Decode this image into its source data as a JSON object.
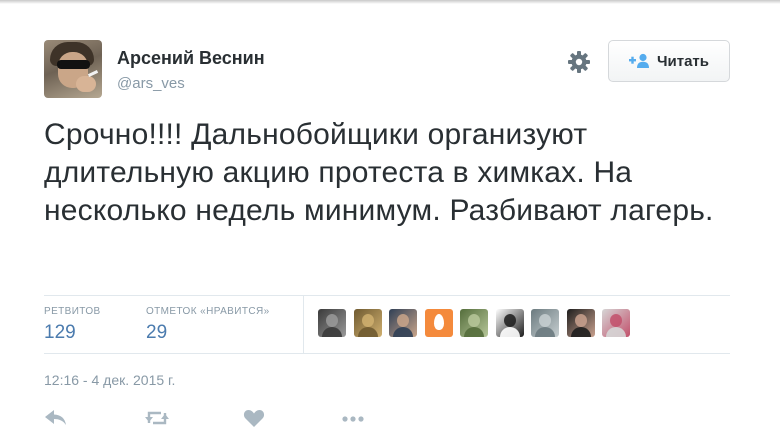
{
  "author": {
    "name": "Арсений Веснин",
    "handle": "@ars_ves"
  },
  "header": {
    "settings_icon": "gear-icon",
    "follow_icon": "add-person-icon",
    "follow_label": "Читать"
  },
  "tweet": {
    "text": "Срочно!!!! Дальнобойщики организуют длительную акцию протеста в химках. На несколько недель минимум. Разбивают лагерь.",
    "timestamp": "12:16 - 4 дек. 2015 г."
  },
  "stats": {
    "retweets_label": "РЕТВИТОВ",
    "retweets_value": "129",
    "likes_label": "ОТМЕТОК «НРАВИТСЯ»",
    "likes_value": "29"
  },
  "favoriters": [
    {
      "kind": "photo",
      "colors": [
        "#3a3a3a",
        "#9a9a9a"
      ]
    },
    {
      "kind": "photo",
      "colors": [
        "#6f5a30",
        "#d0b070"
      ]
    },
    {
      "kind": "photo",
      "colors": [
        "#2f3f55",
        "#c9a58a"
      ]
    },
    {
      "kind": "egg",
      "colors": [
        "#f48a3c",
        "#ffffff"
      ]
    },
    {
      "kind": "photo",
      "colors": [
        "#546d3b",
        "#b7c79a"
      ]
    },
    {
      "kind": "photo",
      "colors": [
        "#ffffff",
        "#1c1c1c"
      ]
    },
    {
      "kind": "photo",
      "colors": [
        "#6b7a7f",
        "#c7cfd1"
      ]
    },
    {
      "kind": "photo",
      "colors": [
        "#1d1d1d",
        "#c9a18e"
      ]
    },
    {
      "kind": "photo",
      "colors": [
        "#d6d6d6",
        "#c2506b"
      ]
    }
  ],
  "actions": [
    "reply-icon",
    "retweet-icon",
    "like-icon",
    "more-icon"
  ],
  "colors": {
    "text": "#292f33",
    "muted": "#8899a6",
    "stat_value": "#4b7bae",
    "action_icon": "#aab8c2"
  }
}
